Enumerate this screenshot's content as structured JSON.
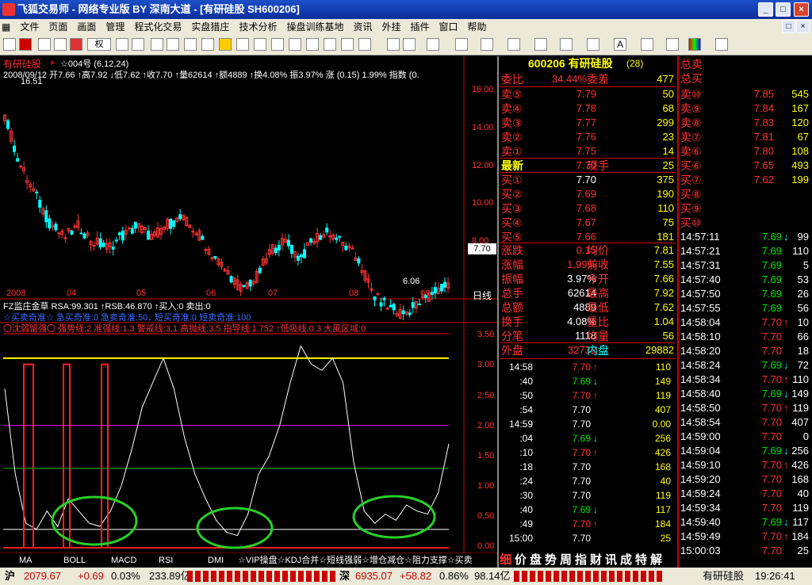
{
  "window": {
    "title": "飞狐交易师 - 网络专业版 BY 深南大道 - [有研硅股 SH600206]",
    "min": "_",
    "max": "□",
    "close": "×"
  },
  "menu": [
    "文件",
    "页面",
    "画面",
    "管理",
    "程式化交易",
    "实盘猎庄",
    "技术分析",
    "操盘训练基地",
    "资讯",
    "外挂",
    "插件",
    "窗口",
    "帮助"
  ],
  "toolbar": {
    "weight_label": "权"
  },
  "chart": {
    "stock_name": "有研硅股",
    "formula": "☆004号 (6,12,24)",
    "info": "2008/09/12 开7.66 ↑高7.92 ↓低7.62 ↑收7.70 ↑量62614 ↑额4889 ↑换4.08% 振3.97% 涨 (0.15) 1.99% 指数 (0.",
    "high_label": "16.51",
    "low_label": "6.06",
    "price_tag": "7.70",
    "y_axis": [
      "16.00",
      "14.00",
      "12.00",
      "10.00",
      "8.00"
    ],
    "x_axis": [
      "2008",
      "04",
      "05",
      "06",
      "07",
      "08",
      "09"
    ],
    "period": "日线"
  },
  "indicator": {
    "line1": "FZ监庄金草 RSA:99.301 ↑RSB:46.870 ↑买入:0 卖出:0",
    "line2": "☆买卖奇准☆ 急买奇准:0 急卖奇准:50↓ 短买奇准:0 短卖奇准:100",
    "line3": "〇沈弱留强〇 强势线:2 准强线:1.3 警戒线:3.1 高抛线:3.5 指导线:1.752 ↑低吸线:0.3 大風区域:0",
    "y_axis": [
      "3.50",
      "3.00",
      "2.50",
      "2.00",
      "1.50",
      "1.00",
      "0.50",
      "0.00"
    ]
  },
  "tabs": [
    "MA",
    "BOLL",
    "MACD",
    "RSI",
    "DMI"
  ],
  "scroll_text": "☆VIP操盘☆KDJ合并☆短线强弱☆增仓减仓☆阻力支撑☆买卖",
  "bottom_bar_text": "价盘势周指财讯成特解",
  "quote": {
    "code_name": "600206 有研硅股",
    "code_suffix": "(28)",
    "weibi": {
      "label": "委比",
      "value": "34.44%",
      "label2": "委差",
      "value2": "477"
    },
    "sell": [
      {
        "label": "卖⑤",
        "price": "7.79",
        "vol": "50"
      },
      {
        "label": "卖④",
        "price": "7.78",
        "vol": "68"
      },
      {
        "label": "卖③",
        "price": "7.77",
        "vol": "299"
      },
      {
        "label": "卖②",
        "price": "7.76",
        "vol": "23"
      },
      {
        "label": "卖①",
        "price": "7.75",
        "vol": "14"
      }
    ],
    "last": {
      "label": "最新",
      "price": "7.70",
      "label2": "现手",
      "vol": "25"
    },
    "buy": [
      {
        "label": "买①",
        "price": "7.70",
        "vol": "375"
      },
      {
        "label": "买②",
        "price": "7.69",
        "vol": "190"
      },
      {
        "label": "买③",
        "price": "7.68",
        "vol": "110"
      },
      {
        "label": "买④",
        "price": "7.67",
        "vol": "75"
      },
      {
        "label": "买⑤",
        "price": "7.66",
        "vol": "181"
      }
    ],
    "stats": [
      {
        "l1": "涨跌",
        "v1": "0.15",
        "l2": "均价",
        "v2": "7.81"
      },
      {
        "l1": "涨幅",
        "v1": "1.99%",
        "l2": "前收",
        "v2": "7.55"
      },
      {
        "l1": "振幅",
        "v1": "3.97%",
        "l2": "今开",
        "v2": "7.66"
      },
      {
        "l1": "总手",
        "v1": "62614",
        "l2": "最高",
        "v2": "7.92"
      },
      {
        "l1": "总额",
        "v1": "4889",
        "l2": "最低",
        "v2": "7.62"
      },
      {
        "l1": "换手",
        "v1": "4.08%",
        "l2": "量比",
        "v2": "1.04"
      },
      {
        "l1": "分笔",
        "v1": "1118",
        "l2": "均量",
        "v2": "56"
      }
    ],
    "outer": {
      "label": "外盘",
      "value": "32732",
      "label2": "内盘",
      "value2": "29882"
    }
  },
  "ticks": [
    {
      "t": "14:58",
      "p": "7.70",
      "a": "↑",
      "v": "110"
    },
    {
      "t": ":40",
      "p": "7.69",
      "a": "↓",
      "v": "149"
    },
    {
      "t": ":50",
      "p": "7.70",
      "a": "↑",
      "v": "119"
    },
    {
      "t": ":54",
      "p": "7.70",
      "a": "",
      "v": "407"
    },
    {
      "t": "14:59",
      "p": "7.70",
      "a": "",
      "v": "0.00"
    },
    {
      "t": ":04",
      "p": "7.69",
      "a": "↓",
      "v": "256"
    },
    {
      "t": ":10",
      "p": "7.70",
      "a": "↑",
      "v": "426"
    },
    {
      "t": ":18",
      "p": "7.70",
      "a": "",
      "v": "168"
    },
    {
      "t": ":24",
      "p": "7.70",
      "a": "",
      "v": "40"
    },
    {
      "t": ":30",
      "p": "7.70",
      "a": "",
      "v": "119"
    },
    {
      "t": ":40",
      "p": "7.69",
      "a": "↓",
      "v": "117"
    },
    {
      "t": ":49",
      "p": "7.70",
      "a": "↑",
      "v": "184"
    },
    {
      "t": "15:00",
      "p": "7.70",
      "a": "",
      "v": "25"
    }
  ],
  "side": {
    "head1": "总卖",
    "head2": "总买",
    "sell": [
      {
        "l": "卖⑩",
        "p": "7.85",
        "v": "545"
      },
      {
        "l": "卖⑨",
        "p": "7.84",
        "v": "167"
      },
      {
        "l": "卖⑧",
        "p": "7.83",
        "v": "120"
      },
      {
        "l": "卖⑦",
        "p": "7.81",
        "v": "67"
      },
      {
        "l": "卖⑥",
        "p": "7.80",
        "v": "108"
      }
    ],
    "buy": [
      {
        "l": "买⑥",
        "p": "7.65",
        "v": "493"
      },
      {
        "l": "买⑦",
        "p": "7.62",
        "v": "199"
      },
      {
        "l": "买⑧",
        "p": "",
        "v": ""
      },
      {
        "l": "买⑨",
        "p": "",
        "v": ""
      },
      {
        "l": "买⑩",
        "p": "",
        "v": ""
      }
    ],
    "ticks": [
      {
        "t": "14:57:11",
        "p": "7.69",
        "a": "↓",
        "v": "99"
      },
      {
        "t": "14:57:21",
        "p": "7.69",
        "a": "",
        "v": "110"
      },
      {
        "t": "14:57:31",
        "p": "7.69",
        "a": "",
        "v": "5"
      },
      {
        "t": "14:57:40",
        "p": "7.69",
        "a": "",
        "v": "53"
      },
      {
        "t": "14:57:50",
        "p": "7.69",
        "a": "",
        "v": "26"
      },
      {
        "t": "14:57:55",
        "p": "7.69",
        "a": "",
        "v": "56"
      },
      {
        "t": "14:58:04",
        "p": "7.70",
        "a": "↑",
        "v": "10"
      },
      {
        "t": "14:58:10",
        "p": "7.70",
        "a": "",
        "v": "66"
      },
      {
        "t": "14:58:20",
        "p": "7.70",
        "a": "",
        "v": "18"
      },
      {
        "t": "14:58:24",
        "p": "7.69",
        "a": "↓",
        "v": "72"
      },
      {
        "t": "14:58:34",
        "p": "7.70",
        "a": "↑",
        "v": "110"
      },
      {
        "t": "14:58:40",
        "p": "7.69",
        "a": "↓",
        "v": "149"
      },
      {
        "t": "14:58:50",
        "p": "7.70",
        "a": "↑",
        "v": "119"
      },
      {
        "t": "14:58:54",
        "p": "7.70",
        "a": "",
        "v": "407"
      },
      {
        "t": "14:59:00",
        "p": "7.70",
        "a": "",
        "v": "0"
      },
      {
        "t": "14:59:04",
        "p": "7.69",
        "a": "↓",
        "v": "256"
      },
      {
        "t": "14:59:10",
        "p": "7.70",
        "a": "↑",
        "v": "426"
      },
      {
        "t": "14:59:20",
        "p": "7.70",
        "a": "",
        "v": "168"
      },
      {
        "t": "14:59:24",
        "p": "7.70",
        "a": "",
        "v": "40"
      },
      {
        "t": "14:59:34",
        "p": "7.70",
        "a": "",
        "v": "119"
      },
      {
        "t": "14:59:40",
        "p": "7.69",
        "a": "↓",
        "v": "117"
      },
      {
        "t": "14:59:49",
        "p": "7.70",
        "a": "↑",
        "v": "184"
      },
      {
        "t": "15:00:03",
        "p": "7.70",
        "a": "",
        "v": "25"
      }
    ]
  },
  "status": {
    "sh_label": "沪",
    "sh_index": "2079.67",
    "sh_change": "+0.69",
    "sh_pct": "0.03%",
    "sh_amount": "233.89亿",
    "sz_label": "深",
    "sz_index": "6935.07",
    "sz_change": "+58.82",
    "sz_pct": "0.86%",
    "sz_amount": "98.14亿",
    "stock": "有研硅股",
    "clock": "19:26:41"
  }
}
